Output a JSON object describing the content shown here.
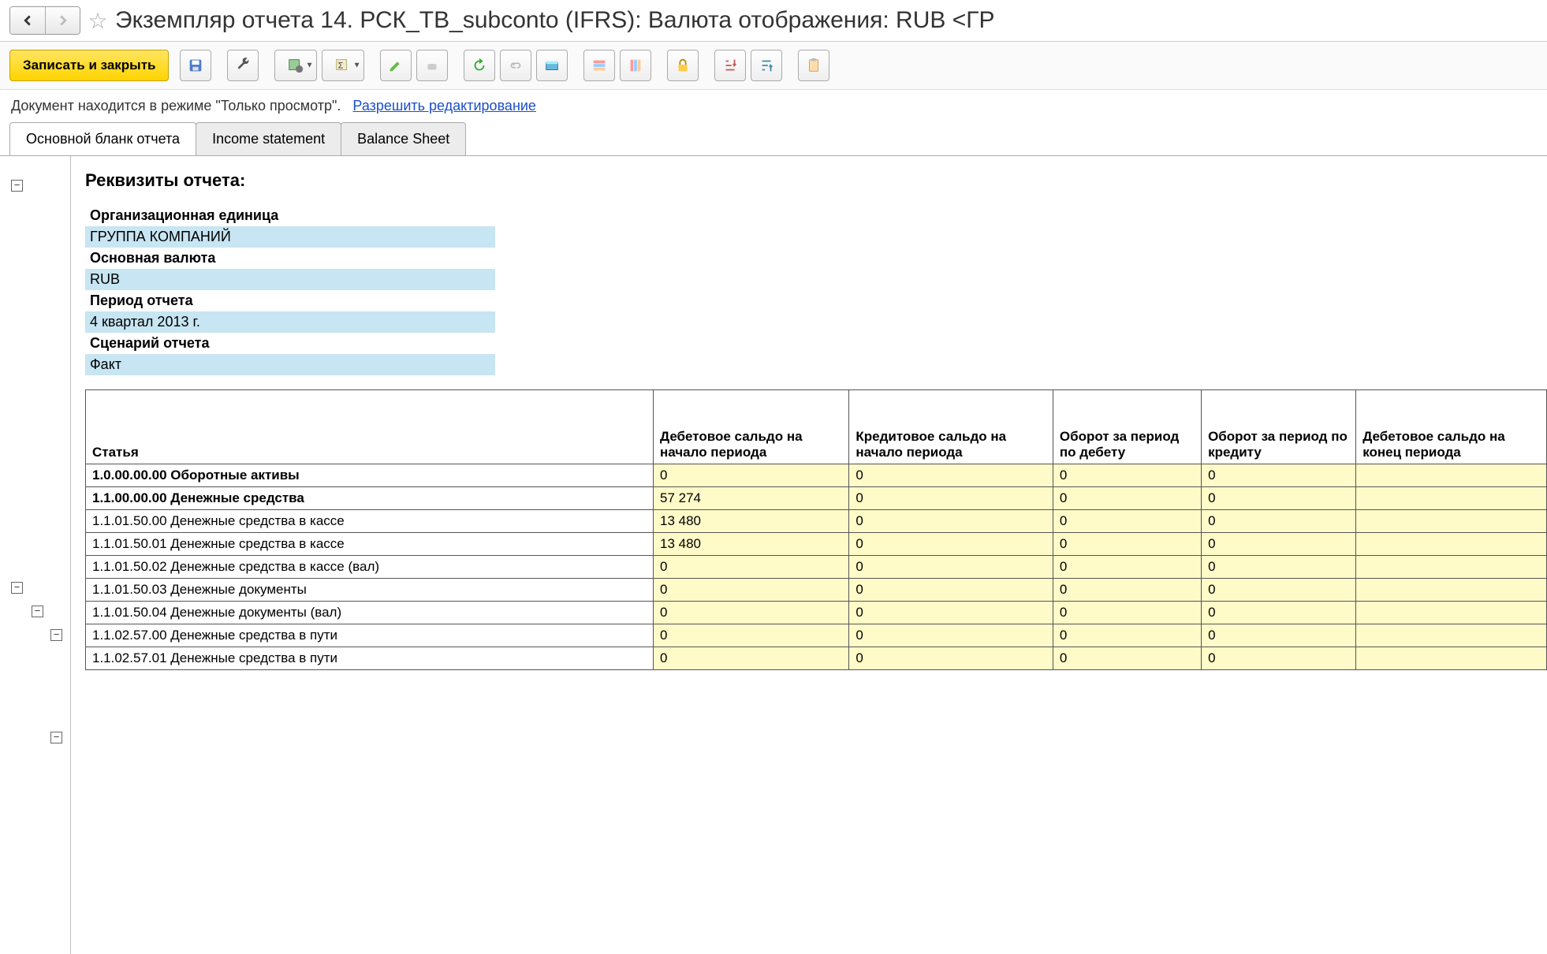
{
  "title": "Экземпляр отчета 14. РСК_ТВ_subconto (IFRS):  Валюта отображения:  RUB <ГР",
  "toolbar": {
    "save_and_close": "Записать и закрыть"
  },
  "status": {
    "text": "Документ находится в режиме \"Только просмотр\".",
    "link": "Разрешить редактирование"
  },
  "tabs": [
    {
      "label": "Основной бланк отчета",
      "active": true
    },
    {
      "label": "Income statement",
      "active": false
    },
    {
      "label": "Balance Sheet",
      "active": false
    }
  ],
  "requisites": {
    "header": "Реквизиты отчета:",
    "items": [
      {
        "label": "Организационная единица",
        "value": "ГРУППА КОМПАНИЙ"
      },
      {
        "label": "Основная валюта",
        "value": "RUB"
      },
      {
        "label": "Период отчета",
        "value": "4 квартал 2013 г."
      },
      {
        "label": "Сценарий отчета",
        "value": "Факт"
      }
    ]
  },
  "columns": [
    "Статья",
    "Дебетовое сальдо на начало периода",
    "Кредитовое сальдо на начало периода",
    "Оборот за период по дебету",
    "Оборот за период по кредиту",
    "Дебетовое сальдо на конец периода"
  ],
  "rows": [
    {
      "bold": true,
      "article": "1.0.00.00.00 Оборотные активы",
      "v": [
        "0",
        "0",
        "0",
        "0",
        ""
      ]
    },
    {
      "bold": true,
      "article": "1.1.00.00.00 Денежные средства",
      "v": [
        "57 274",
        "0",
        "0",
        "0",
        ""
      ]
    },
    {
      "bold": false,
      "article": "1.1.01.50.00 Денежные средства в кассе",
      "v": [
        "13 480",
        "0",
        "0",
        "0",
        ""
      ]
    },
    {
      "bold": false,
      "article": "1.1.01.50.01 Денежные средства в кассе",
      "v": [
        "13 480",
        "0",
        "0",
        "0",
        ""
      ]
    },
    {
      "bold": false,
      "article": "1.1.01.50.02 Денежные средства в кассе (вал)",
      "v": [
        "0",
        "0",
        "0",
        "0",
        ""
      ]
    },
    {
      "bold": false,
      "article": "1.1.01.50.03 Денежные документы",
      "v": [
        "0",
        "0",
        "0",
        "0",
        ""
      ]
    },
    {
      "bold": false,
      "article": "1.1.01.50.04 Денежные документы (вал)",
      "v": [
        "0",
        "0",
        "0",
        "0",
        ""
      ]
    },
    {
      "bold": false,
      "article": "1.1.02.57.00 Денежные средства в пути",
      "v": [
        "0",
        "0",
        "0",
        "0",
        ""
      ]
    },
    {
      "bold": false,
      "article": "1.1.02.57.01 Денежные средства в пути",
      "v": [
        "0",
        "0",
        "0",
        "0",
        ""
      ]
    }
  ]
}
